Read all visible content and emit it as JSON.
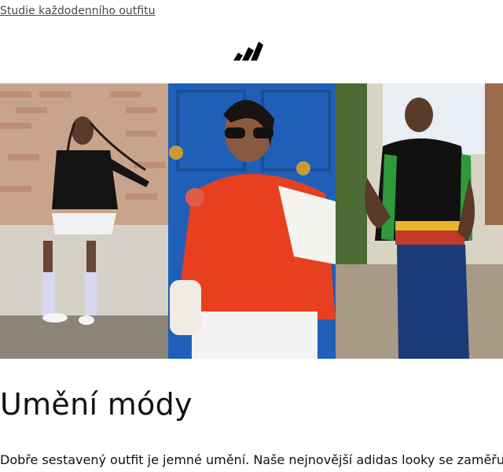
{
  "preheader": {
    "link_text": "Studie každodenního outfitu"
  },
  "brand": {
    "logo_icon": "adidas-logo-icon"
  },
  "hero": {
    "panels": [
      {
        "name": "hero-photo-1",
        "subject": "woman-in-black-track-jacket"
      },
      {
        "name": "hero-photo-2",
        "subject": "woman-in-orange-windbreaker"
      },
      {
        "name": "hero-photo-3",
        "subject": "man-in-jamaica-jersey"
      }
    ]
  },
  "headline": "Umění módy",
  "body": "Dobře sestavený outfit je jemné umění. Naše nejnovější adidas looky se zaměřují na"
}
